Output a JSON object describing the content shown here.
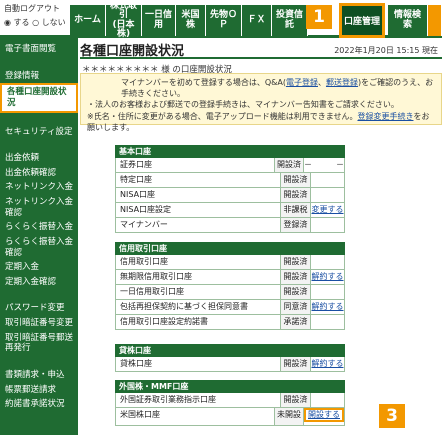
{
  "header": {
    "logout_title": "自動ログアウト",
    "logout_on": "◉ する",
    "logout_off": "○ しない",
    "tabs": [
      "ホーム",
      "株式取引\n(日本株)",
      "一日信用",
      "米国株",
      "先物ＯＰ",
      "ＦＸ",
      "投資信託"
    ],
    "active_tab": "口座管理",
    "extra_tab": "情報検索"
  },
  "badges": [
    "1",
    "2",
    "3"
  ],
  "sidebar": {
    "groups": [
      [
        "電子書面閲覧"
      ],
      [
        "登録情報",
        "各種口座開設状況"
      ],
      [
        "セキュリティ設定"
      ],
      [
        "出金依頼",
        "出金依頼確認",
        "ネットリンク入金",
        "ネットリンク入金確認",
        "らくらく振替入金",
        "らくらく振替入金確認",
        "定期入金",
        "定期入金確認"
      ],
      [
        "パスワード変更",
        "取引暗証番号変更",
        "取引暗証番号郵送再発行"
      ],
      [
        "書類請求・申込",
        "帳票郵送請求",
        "約諾書承諾状況"
      ]
    ],
    "selected": "各種口座開設状況"
  },
  "main": {
    "title": "各種口座開設状況",
    "date": "2022年1月20日 15:15 現在",
    "user": "＊＊＊＊＊＊＊＊＊ 様 の口座開設状況",
    "notice_line1": "マイナンバーを初めて登録する場合は、Q&A(",
    "notice_link1": "電子登録",
    "notice_sep": "、",
    "notice_link2": "郵送登録",
    "notice_line1b": ")をご確認のうえ、お手続きください。",
    "notice_line2": "・法人のお客様および郵送での登録手続きは、マイナンバー告知書をご請求ください。",
    "notice_line3": "※氏名・住所に変更がある場合、電子アップロード機能は利用できません。",
    "notice_link3": "登録変更手続き",
    "notice_line3b": "をお願いします。"
  },
  "sections": [
    {
      "heading": "基本口座",
      "rows": [
        {
          "name": "証券口座",
          "status": "開設済",
          "action": "－",
          "extra": "－"
        },
        {
          "name": "特定口座",
          "status": "開設済",
          "action": "",
          "extra": ""
        },
        {
          "name": "NISA口座",
          "status": "開設済",
          "action": "",
          "extra": ""
        },
        {
          "name": "NISA口座設定",
          "status": "非課税",
          "action": "変更する",
          "extra": ""
        },
        {
          "name": "マイナンバー",
          "status": "登録済",
          "action": "",
          "extra": ""
        }
      ]
    },
    {
      "heading": "信用取引口座",
      "rows": [
        {
          "name": "信用取引口座",
          "status": "開設済",
          "action": "",
          "extra": ""
        },
        {
          "name": "無期限信用取引口座",
          "status": "開設済",
          "action": "解約する",
          "extra": ""
        },
        {
          "name": "一日信用取引口座",
          "status": "開設済",
          "action": "",
          "extra": ""
        },
        {
          "name": "包括再担保契約に基づく担保同意書",
          "status": "同意済",
          "action": "解約する",
          "extra": ""
        },
        {
          "name": "信用取引口座設定約諾書",
          "status": "承諾済",
          "action": "",
          "extra": ""
        }
      ]
    },
    {
      "heading": "貸株口座",
      "rows": [
        {
          "name": "貸株口座",
          "status": "開設済",
          "action": "解約する",
          "extra": ""
        }
      ]
    },
    {
      "heading": "外国株・MMF口座",
      "rows": [
        {
          "name": "外国証券取引業務指示口座",
          "status": "開設済",
          "action": "",
          "extra": ""
        },
        {
          "name": "米国株口座",
          "status": "未開設",
          "action": "開設する",
          "extra": ""
        }
      ]
    }
  ]
}
